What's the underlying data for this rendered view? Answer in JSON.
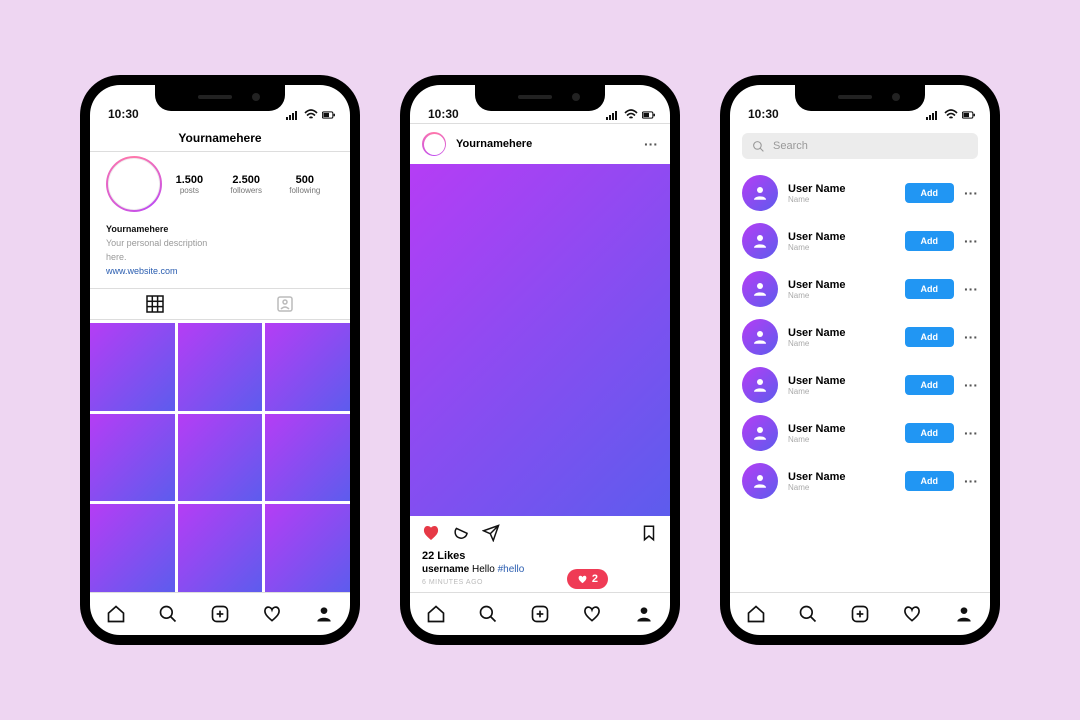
{
  "status": {
    "time": "10:30"
  },
  "profile": {
    "title": "Yournamehere",
    "stats": [
      {
        "count": "1.500",
        "label": "posts"
      },
      {
        "count": "2.500",
        "label": "followers"
      },
      {
        "count": "500",
        "label": "following"
      }
    ],
    "bio_name": "Yournamehere",
    "bio_line1": "Your personal description",
    "bio_line2": "here.",
    "bio_link": "www.website.com"
  },
  "post": {
    "author": "Yournamehere",
    "likes": "22 Likes",
    "caption_user": "username",
    "caption_text": " Hello ",
    "caption_hash": "#hello",
    "timestamp": "6 MINUTES AGO",
    "notif_count": "2"
  },
  "search": {
    "placeholder": "Search",
    "users": [
      {
        "name": "User Name",
        "sub": "Name",
        "btn": "Add"
      },
      {
        "name": "User Name",
        "sub": "Name",
        "btn": "Add"
      },
      {
        "name": "User Name",
        "sub": "Name",
        "btn": "Add"
      },
      {
        "name": "User Name",
        "sub": "Name",
        "btn": "Add"
      },
      {
        "name": "User Name",
        "sub": "Name",
        "btn": "Add"
      },
      {
        "name": "User Name",
        "sub": "Name",
        "btn": "Add"
      },
      {
        "name": "User Name",
        "sub": "Name",
        "btn": "Add"
      }
    ]
  }
}
